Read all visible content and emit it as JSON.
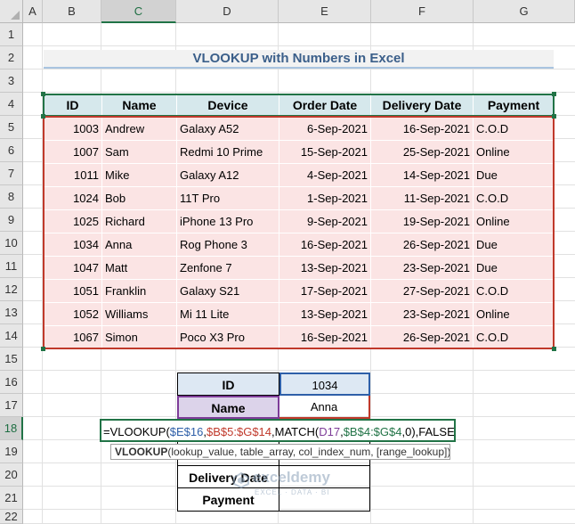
{
  "sheet": {
    "columns": [
      "A",
      "B",
      "C",
      "D",
      "E",
      "F",
      "G"
    ],
    "rows": [
      "1",
      "2",
      "3",
      "4",
      "5",
      "6",
      "7",
      "8",
      "9",
      "10",
      "11",
      "12",
      "13",
      "14",
      "15",
      "16",
      "17",
      "18",
      "19",
      "20",
      "21",
      "22"
    ]
  },
  "title": "VLOOKUP with Numbers in Excel",
  "table": {
    "headers": [
      "ID",
      "Name",
      "Device",
      "Order Date",
      "Delivery Date",
      "Payment"
    ],
    "rows": [
      [
        "1003",
        "Andrew",
        "Galaxy A52",
        "6-Sep-2021",
        "16-Sep-2021",
        "C.O.D"
      ],
      [
        "1007",
        "Sam",
        "Redmi 10 Prime",
        "15-Sep-2021",
        "25-Sep-2021",
        "Online"
      ],
      [
        "1011",
        "Mike",
        "Galaxy A12",
        "4-Sep-2021",
        "14-Sep-2021",
        "Due"
      ],
      [
        "1024",
        "Bob",
        "11T Pro",
        "1-Sep-2021",
        "11-Sep-2021",
        "C.O.D"
      ],
      [
        "1025",
        "Richard",
        "iPhone 13 Pro",
        "9-Sep-2021",
        "19-Sep-2021",
        "Online"
      ],
      [
        "1034",
        "Anna",
        "Rog Phone 3",
        "16-Sep-2021",
        "26-Sep-2021",
        "Due"
      ],
      [
        "1047",
        "Matt",
        "Zenfone 7",
        "13-Sep-2021",
        "23-Sep-2021",
        "Due"
      ],
      [
        "1051",
        "Franklin",
        "Galaxy S21",
        "17-Sep-2021",
        "27-Sep-2021",
        "C.O.D"
      ],
      [
        "1052",
        "Williams",
        "Mi 11 Lite",
        "13-Sep-2021",
        "23-Sep-2021",
        "Online"
      ],
      [
        "1067",
        "Simon",
        "Poco X3 Pro",
        "16-Sep-2021",
        "26-Sep-2021",
        "C.O.D"
      ]
    ]
  },
  "lookup": {
    "id_label": "ID",
    "id_value": "1034",
    "name_label": "Name",
    "name_value": "Anna",
    "delivery_label": "Delivery Date",
    "payment_label": "Payment"
  },
  "formula": {
    "parts": [
      "=VLOOKUP(",
      "$E$16",
      ",",
      "$B$5:$G$14",
      ",MATCH(",
      "D17",
      ",",
      "$B$4:$G$4",
      ",0),FALSE)"
    ]
  },
  "tooltip": {
    "func": "VLOOKUP",
    "args": "(lookup_value, table_array, col_index_num, [range_lookup])"
  },
  "watermark": {
    "brand": "exceldemy",
    "tagline": "EXCEL · DATA · BI"
  },
  "colors": {
    "header_fill": "#d6e8ec",
    "body_fill": "#fbe4e4",
    "header_border": "#217346",
    "body_border": "#c0392b",
    "lookup_fill": "#dde8f3"
  }
}
